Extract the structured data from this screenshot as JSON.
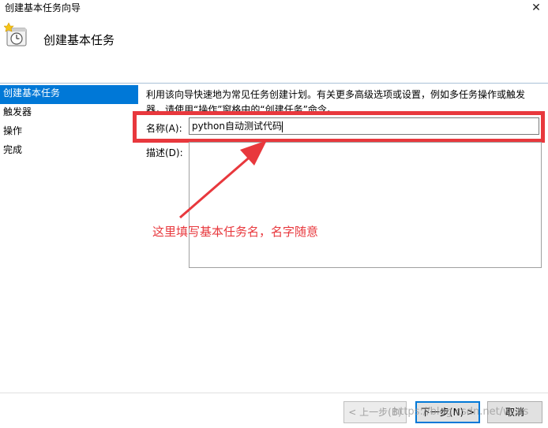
{
  "window": {
    "title": "创建基本任务向导",
    "close_glyph": "✕"
  },
  "header": {
    "title": "创建基本任务"
  },
  "sidebar": {
    "items": [
      {
        "label": "创建基本任务",
        "active": true
      },
      {
        "label": "触发器"
      },
      {
        "label": "操作"
      },
      {
        "label": "完成"
      }
    ]
  },
  "main": {
    "description": "利用该向导快速地为常见任务创建计划。有关更多高级选项或设置，例如多任务操作或触发器，请使用“操作”窗格中的“创建任务”命令。",
    "name_label": "名称(A):",
    "name_value": "python自动测试代码",
    "desc_label": "描述(D):",
    "desc_value": ""
  },
  "annotation": {
    "text": "这里填写基本任务名，名字随意",
    "color": "#e8383d"
  },
  "footer": {
    "back_label": "< 上一步(B)",
    "next_label": "下一步(N) >",
    "cancel_label": "取消"
  },
  "watermark": "https://blog.csdn.net/w..xs",
  "colors": {
    "accent": "#0078d7",
    "highlight": "#e8383d"
  }
}
